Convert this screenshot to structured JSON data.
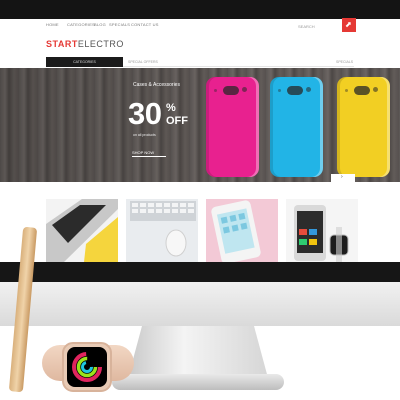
{
  "site": {
    "nav_items": [
      "HOME",
      "CATEGORIES",
      "BLOG",
      "SPECIALS",
      "CONTACT US"
    ],
    "search_text": "SEARCH",
    "logo_brand": "START",
    "logo_rest": "ELECTRO"
  },
  "catbar": {
    "button_label": "CATEGORIES",
    "items": [
      "SPECIAL OFFERS",
      "SPECIALS"
    ]
  },
  "hero": {
    "promo_top": "Cases & Accessories",
    "promo_number": "30",
    "promo_percent": "%",
    "promo_off": "OFF",
    "promo_sub": "on all products",
    "button_label": "SHOP NOW",
    "phone_colors": [
      "#e8218f",
      "#22b4e6",
      "#f2cf23"
    ]
  },
  "colors": {
    "accent": "#e53935",
    "hero_wood": "#5b5654",
    "bezel": "#141414"
  },
  "icons": {
    "cart": "cart-icon",
    "slider": "chevron-right-icon"
  }
}
